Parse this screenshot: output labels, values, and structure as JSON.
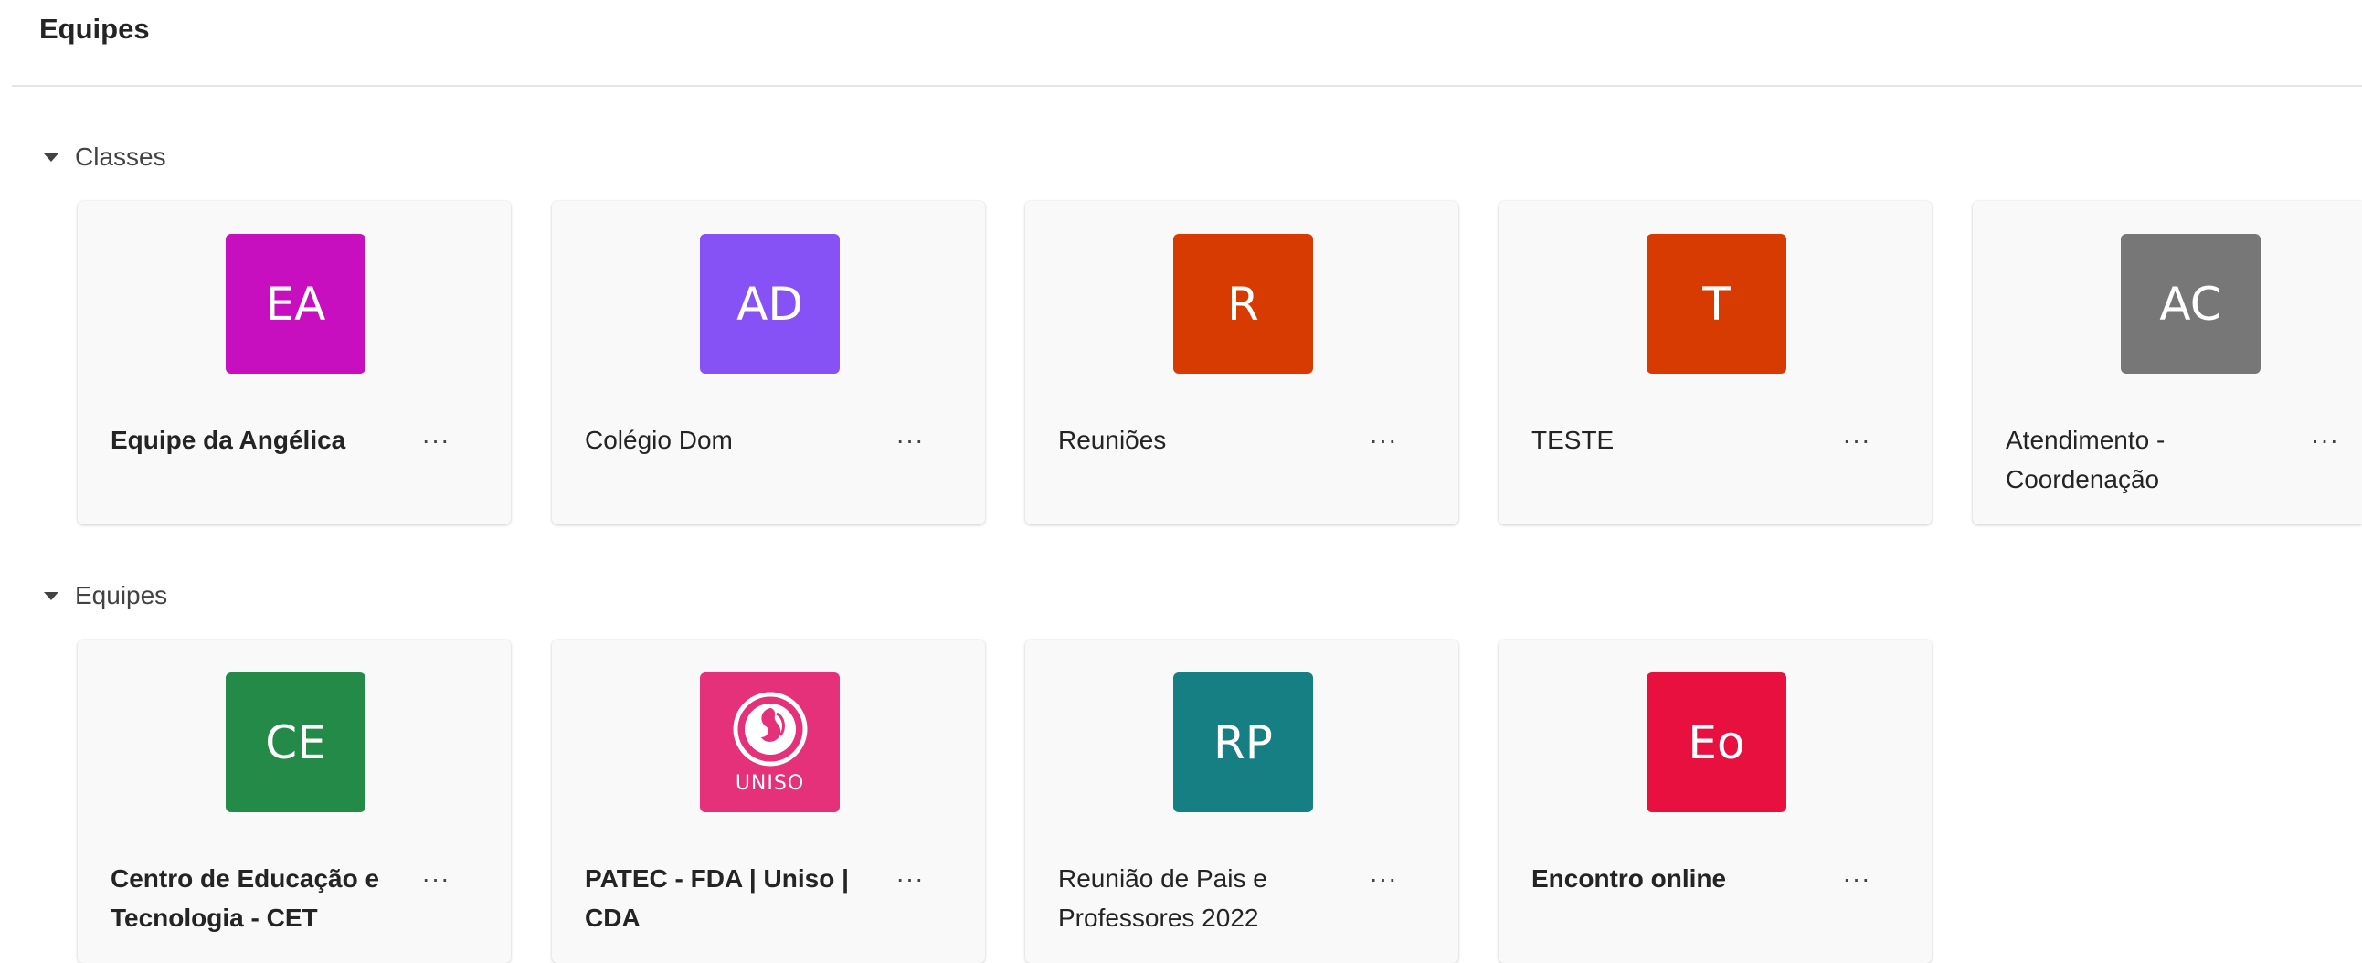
{
  "header": {
    "title": "Equipes"
  },
  "sections": [
    {
      "label": "Classes",
      "cards": [
        {
          "initials": "EA",
          "color": "#c80fc0",
          "name_line1": "Equipe da Angélica",
          "name_line2": "",
          "bold": true
        },
        {
          "initials": "AD",
          "color": "#8651f5",
          "name_line1": "Colégio Dom",
          "name_line2": "",
          "bold": false
        },
        {
          "initials": "R",
          "color": "#d83b01",
          "name_line1": "Reuniões",
          "name_line2": "",
          "bold": false
        },
        {
          "initials": "T",
          "color": "#d83b01",
          "name_line1": "TESTE",
          "name_line2": "",
          "bold": false
        },
        {
          "initials": "AC",
          "color": "#777777",
          "name_line1": "Atendimento -",
          "name_line2": "Coordenação",
          "bold": false
        }
      ]
    },
    {
      "label": "Equipes",
      "cards": [
        {
          "initials": "CE",
          "color": "#238a47",
          "name_line1": "Centro de Educação e",
          "name_line2": "Tecnologia - CET",
          "bold": true
        },
        {
          "initials": "",
          "logo_text": "UNISO",
          "icon": "uniso-logo",
          "color": "#e5317a",
          "name_line1": "PATEC - FDA | Uniso |",
          "name_line2": "CDA",
          "bold": true
        },
        {
          "initials": "RP",
          "color": "#157f83",
          "name_line1": "Reunião de Pais e",
          "name_line2": "Professores 2022",
          "bold": false
        },
        {
          "initials": "Eo",
          "color": "#e8103f",
          "name_line1": "Encontro online",
          "name_line2": "",
          "bold": true
        }
      ]
    }
  ],
  "more_label": "···",
  "icons": {
    "collapse": "caret-down-icon",
    "more": "more-options-icon"
  }
}
